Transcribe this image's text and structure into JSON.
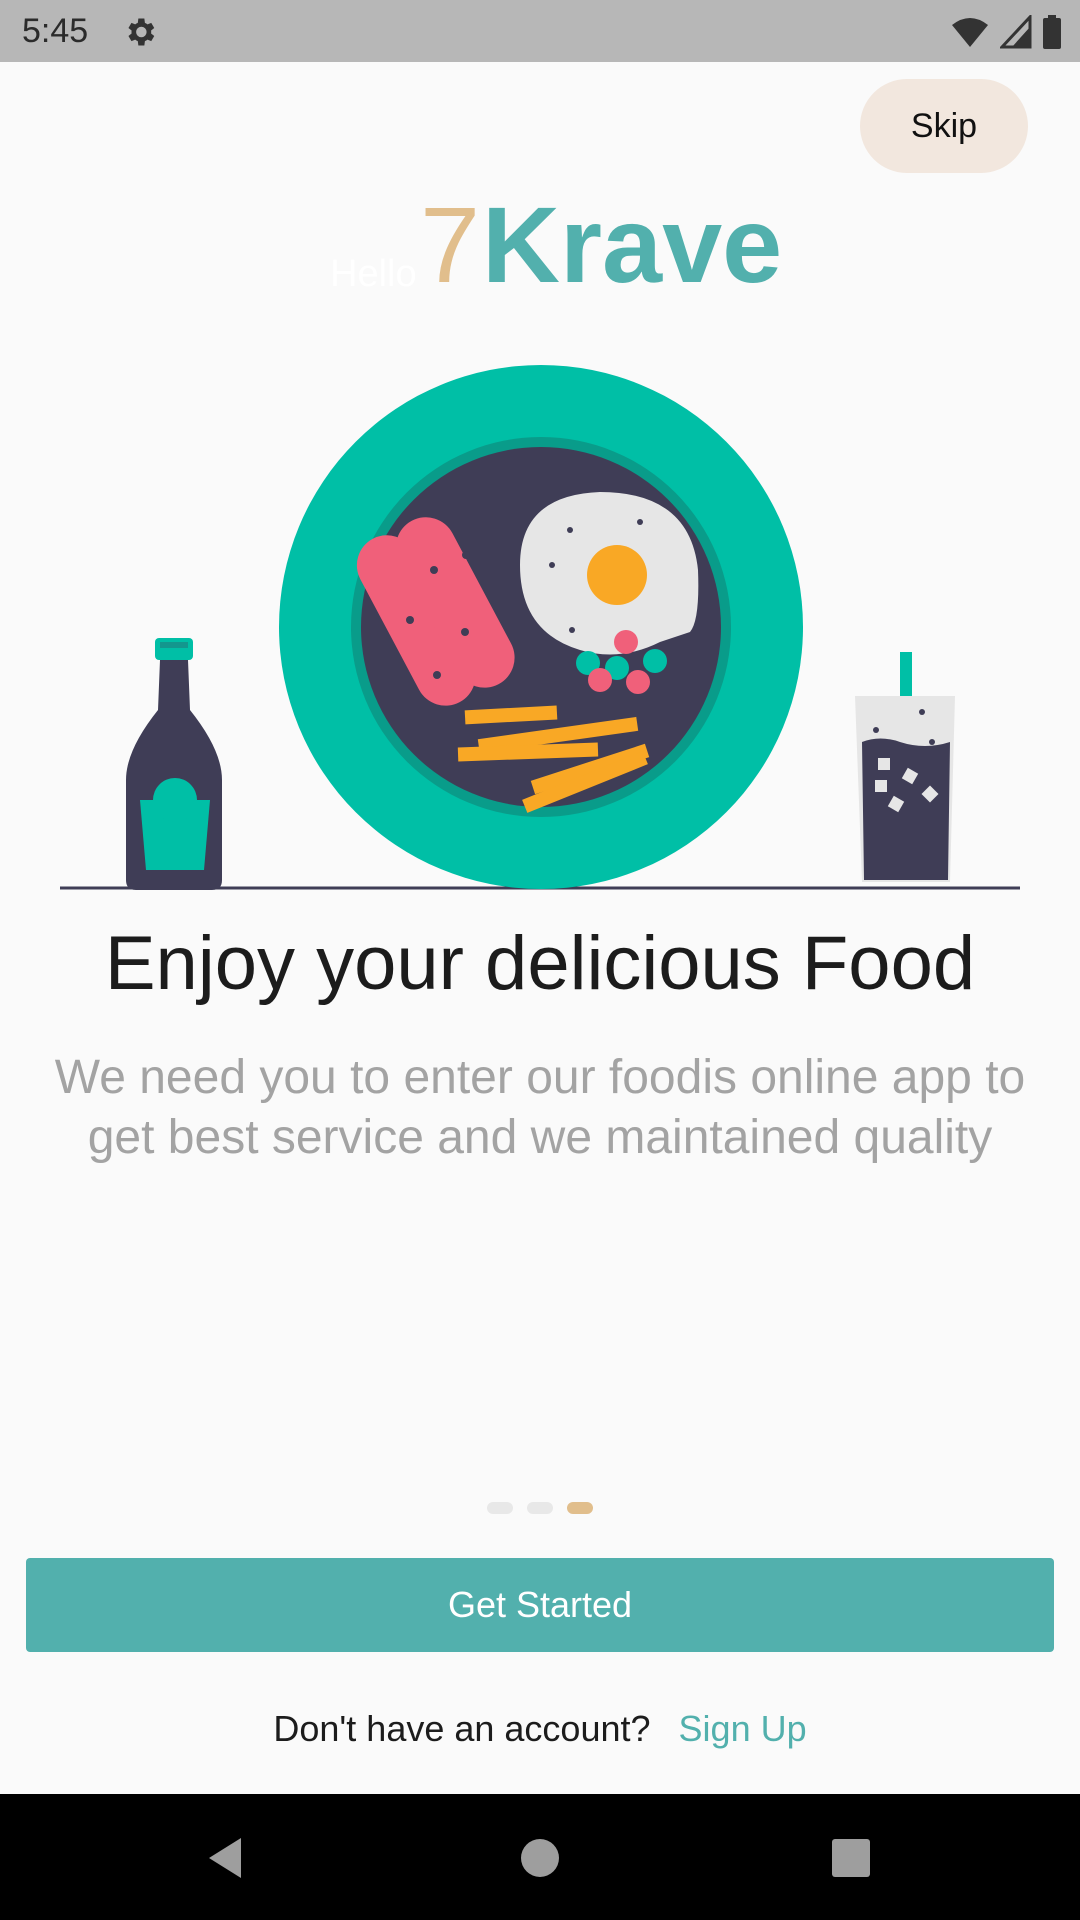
{
  "status": {
    "time": "5:45"
  },
  "skip_label": "Skip",
  "logo": {
    "hello": "Hello",
    "seven": "7",
    "krave": "Krave"
  },
  "title": "Enjoy your delicious Food",
  "description": "We need you to enter our foodis online app to get best service and we maintained quality",
  "pager": {
    "count": 3,
    "active_index": 2
  },
  "cta_label": "Get Started",
  "signup": {
    "prompt": "Don't have an account?",
    "link": "Sign Up"
  },
  "colors": {
    "accent": "#52b0ad",
    "gold": "#e1be8c",
    "skip_bg": "#f2e7de",
    "plate": "#00bfa6",
    "dark": "#3f3d56"
  }
}
